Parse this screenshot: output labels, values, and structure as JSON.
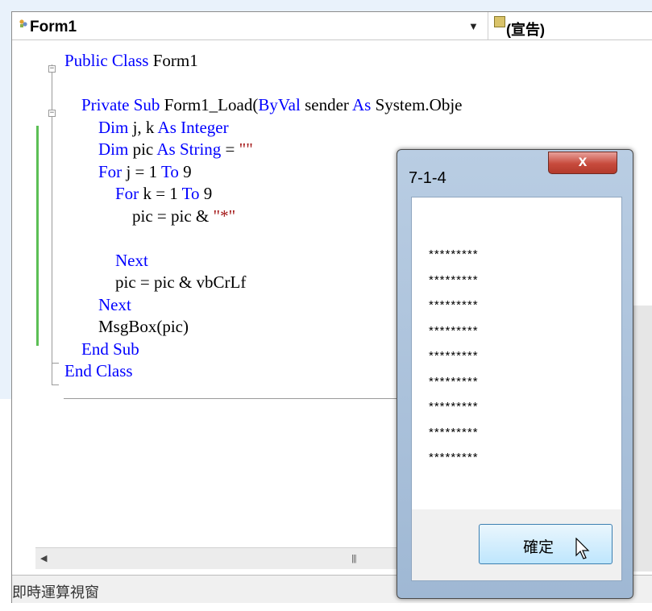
{
  "toolbar": {
    "class_combo": "Form1",
    "member_combo": "(宣告)"
  },
  "code": {
    "lines": [
      {
        "indent": "",
        "parts": [
          {
            "t": "Public ",
            "c": "kw"
          },
          {
            "t": "Class ",
            "c": "kw"
          },
          {
            "t": "Form1",
            "c": ""
          }
        ]
      },
      {
        "indent": "",
        "parts": []
      },
      {
        "indent": "    ",
        "parts": [
          {
            "t": "Private ",
            "c": "kw"
          },
          {
            "t": "Sub ",
            "c": "kw"
          },
          {
            "t": "Form1_Load(",
            "c": ""
          },
          {
            "t": "ByVal",
            "c": "kw"
          },
          {
            "t": " sender ",
            "c": ""
          },
          {
            "t": "As",
            "c": "kw"
          },
          {
            "t": " System.Obje",
            "c": ""
          }
        ]
      },
      {
        "indent": "        ",
        "parts": [
          {
            "t": "Dim",
            "c": "kw"
          },
          {
            "t": " j, k ",
            "c": ""
          },
          {
            "t": "As",
            "c": "kw"
          },
          {
            "t": " ",
            "c": ""
          },
          {
            "t": "Integer",
            "c": "kw"
          }
        ]
      },
      {
        "indent": "        ",
        "parts": [
          {
            "t": "Dim",
            "c": "kw"
          },
          {
            "t": " pic ",
            "c": ""
          },
          {
            "t": "As",
            "c": "kw"
          },
          {
            "t": " ",
            "c": ""
          },
          {
            "t": "String",
            "c": "kw"
          },
          {
            "t": " = ",
            "c": ""
          },
          {
            "t": "\"\"",
            "c": "str"
          }
        ]
      },
      {
        "indent": "        ",
        "parts": [
          {
            "t": "For",
            "c": "kw"
          },
          {
            "t": " j = 1 ",
            "c": ""
          },
          {
            "t": "To",
            "c": "kw"
          },
          {
            "t": " 9",
            "c": ""
          }
        ]
      },
      {
        "indent": "            ",
        "parts": [
          {
            "t": "For",
            "c": "kw"
          },
          {
            "t": " k = 1 ",
            "c": ""
          },
          {
            "t": "To",
            "c": "kw"
          },
          {
            "t": " 9",
            "c": ""
          }
        ]
      },
      {
        "indent": "                ",
        "parts": [
          {
            "t": "pic = pic & ",
            "c": ""
          },
          {
            "t": "\"*\"",
            "c": "str"
          }
        ]
      },
      {
        "indent": "",
        "parts": []
      },
      {
        "indent": "            ",
        "parts": [
          {
            "t": "Next",
            "c": "kw"
          }
        ]
      },
      {
        "indent": "            ",
        "parts": [
          {
            "t": "pic = pic & vbCrLf",
            "c": ""
          }
        ]
      },
      {
        "indent": "        ",
        "parts": [
          {
            "t": "Next",
            "c": "kw"
          }
        ]
      },
      {
        "indent": "        ",
        "parts": [
          {
            "t": "MsgBox(pic)",
            "c": ""
          }
        ]
      },
      {
        "indent": "    ",
        "parts": [
          {
            "t": "End ",
            "c": "kw"
          },
          {
            "t": "Sub",
            "c": "kw"
          }
        ]
      },
      {
        "indent": "",
        "parts": [
          {
            "t": "End ",
            "c": "kw"
          },
          {
            "t": "Class",
            "c": "kw"
          }
        ]
      }
    ]
  },
  "bottom_panel": {
    "title": "即時運算視窗"
  },
  "dialog": {
    "title": "7-1-4",
    "close_glyph": "x",
    "message_lines": [
      "*********",
      "*********",
      "*********",
      "*********",
      "*********",
      "*********",
      "*********",
      "*********",
      "*********"
    ],
    "ok_label": "確定"
  }
}
